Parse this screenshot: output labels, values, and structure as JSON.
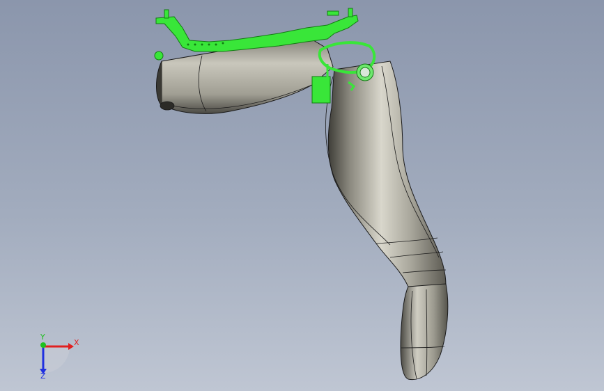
{
  "viewport": {
    "background_top": "#8b96ac",
    "background_bottom": "#bfc6d3"
  },
  "model": {
    "shell_color": "#b4b2a6",
    "edge_color": "#1a1a1a",
    "highlight_color": "#39e639"
  },
  "triad": {
    "x_label": "X",
    "y_label": "Y",
    "z_label": "Z",
    "x_color": "#e02020",
    "y_color": "#20c020",
    "z_color": "#2030e0"
  }
}
